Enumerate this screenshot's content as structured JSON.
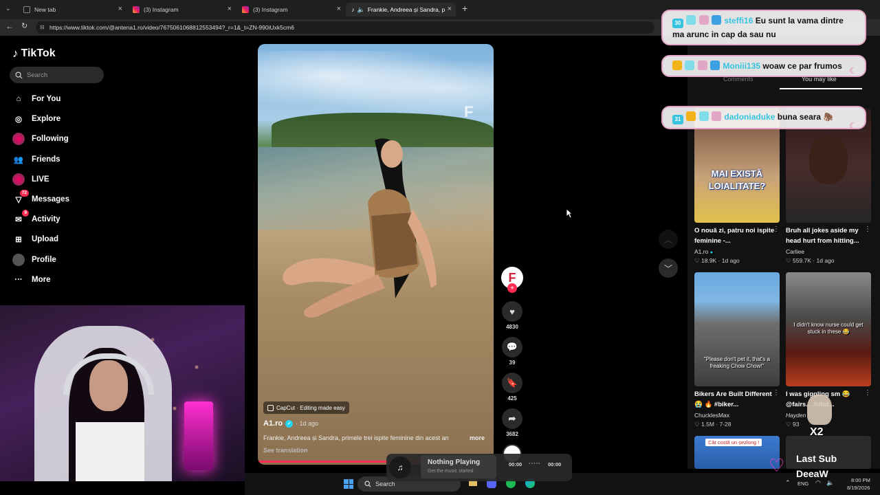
{
  "browser": {
    "tabs": [
      {
        "label": "New tab"
      },
      {
        "label": "(3) Instagram"
      },
      {
        "label": "(3) Instagram"
      },
      {
        "label": "Frankie, Andreea și Sandra, pr"
      }
    ],
    "url": "https://www.tiktok.com/@antena1.ro/video/7675061068812553494?_r=1&_t=ZN-990iUxk5cm6"
  },
  "tiktok": {
    "logo": "TikTok",
    "search_placeholder": "Search",
    "nav": [
      {
        "label": "For You",
        "icon": "home-icon"
      },
      {
        "label": "Explore",
        "icon": "compass-icon"
      },
      {
        "label": "Following",
        "icon": "following-avatar-icon"
      },
      {
        "label": "Friends",
        "icon": "friends-icon"
      },
      {
        "label": "LIVE",
        "icon": "live-icon"
      },
      {
        "label": "Messages",
        "icon": "messages-icon",
        "badge": "72"
      },
      {
        "label": "Activity",
        "icon": "activity-icon",
        "badge": "9"
      },
      {
        "label": "Upload",
        "icon": "upload-icon"
      },
      {
        "label": "Profile",
        "icon": "profile-avatar-icon"
      },
      {
        "label": "More",
        "icon": "more-icon"
      }
    ]
  },
  "video": {
    "capcut_label": "CapCut · Editing made easy",
    "author": "A1.ro",
    "posted": "· 1d ago",
    "caption": "Frankie, Andreea și Sandra, primele trei ispite feminine din acest an",
    "caption_more": "more",
    "see_translation": "See translation",
    "progress": 0.9,
    "avatar_letter": "F"
  },
  "actions": {
    "likes": "4830",
    "comments": "39",
    "saves": "425",
    "shares": "3682"
  },
  "recommendations": [
    {
      "title": "O nouă zi, patru noi ispite feminine -...",
      "author": "A1.ro",
      "views": "18.9K",
      "age": "1d ago",
      "overlay": "MAI EXISTĂ LOIALITATE?"
    },
    {
      "title": "Bruh all jokes aside my head hurt from hitting...",
      "author": "Carliee",
      "views": "559.7K",
      "age": "1d ago",
      "overlay": ""
    },
    {
      "title": "Bikers Are Built Different 😭 🔥 #biker...",
      "author": "ChucklesMax",
      "views": "1.5M",
      "age": "7-28",
      "overlay": "\"Please don't pet it, that's a freaking Chow Chow!\""
    },
    {
      "title": "I was giggling sm 😂 @fairs... #dbd...",
      "author": "Hayden",
      "views": "93",
      "age": "",
      "overlay": "I didn't know nurse could get stuck in these 😂"
    },
    {
      "title": "",
      "author": "",
      "views": "",
      "age": "",
      "overlay": "Cât costă un șezlong !"
    }
  ],
  "ghost_labels": {
    "comments": "Comments",
    "you_may_like": "You may like"
  },
  "chat": [
    {
      "level": "30",
      "user": "steffi16",
      "message": "Eu sunt la vama dintre ma arunc in cap da sau nu"
    },
    {
      "level": "",
      "user": "Moniii135",
      "message": "woaw ce par frumos"
    },
    {
      "level": "31",
      "user": "dadoniaduke",
      "message": "buna seara 🦣"
    }
  ],
  "music_widget": {
    "title": "Nothing Playing",
    "subtitle": "Get the music started",
    "time_start": "00:00",
    "time_end": "00:00"
  },
  "stream_overlay": {
    "last_sub_label": "Last Sub",
    "last_sub_name": "DeeaW",
    "multiplier": "X2"
  },
  "taskbar": {
    "search": "Search",
    "lang": "ENG",
    "time": "8:00 PM",
    "date": "8/19/2026"
  },
  "colors": {
    "accent": "#fe2c55",
    "verified": "#20d5ec",
    "chat_user": "#36c3e0",
    "chat_border": "#e2a6c6"
  }
}
